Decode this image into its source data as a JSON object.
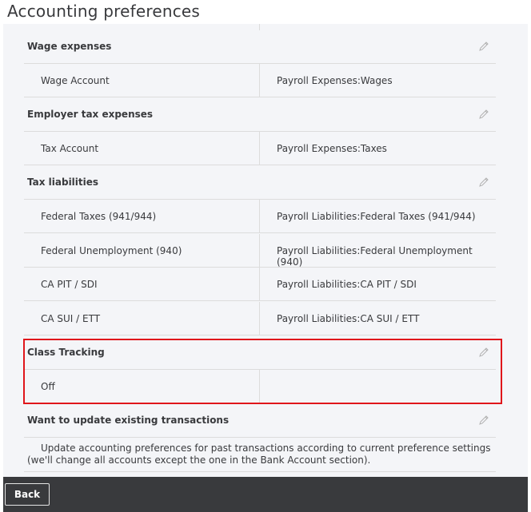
{
  "page": {
    "title": "Accounting preferences"
  },
  "sections": {
    "wage_expenses": {
      "label": "Wage expenses",
      "rows": [
        {
          "name": "Wage Account",
          "value": "Payroll Expenses:Wages"
        }
      ]
    },
    "employer_tax_expenses": {
      "label": "Employer tax expenses",
      "rows": [
        {
          "name": "Tax Account",
          "value": "Payroll Expenses:Taxes"
        }
      ]
    },
    "tax_liabilities": {
      "label": "Tax liabilities",
      "rows": [
        {
          "name": "Federal Taxes (941/944)",
          "value": "Payroll Liabilities:Federal Taxes (941/944)"
        },
        {
          "name": "Federal Unemployment (940)",
          "value": "Payroll Liabilities:Federal Unemployment (940)"
        },
        {
          "name": "CA PIT / SDI",
          "value": "Payroll Liabilities:CA PIT / SDI"
        },
        {
          "name": "CA SUI / ETT",
          "value": "Payroll Liabilities:CA SUI / ETT"
        }
      ]
    },
    "class_tracking": {
      "label": "Class Tracking",
      "rows": [
        {
          "name": "Off",
          "value": ""
        }
      ]
    },
    "update_existing": {
      "label": "Want to update existing transactions",
      "line1": "Update accounting preferences for past transactions according to current preference settings",
      "line2": "(we'll change all accounts except the one in the Bank Account section)."
    }
  },
  "footer": {
    "back_label": "Back"
  },
  "icons": {
    "edit": "pencil-icon"
  },
  "colors": {
    "highlight": "#e0161b",
    "panel": "#f4f5f8",
    "footer": "#393a3d"
  }
}
